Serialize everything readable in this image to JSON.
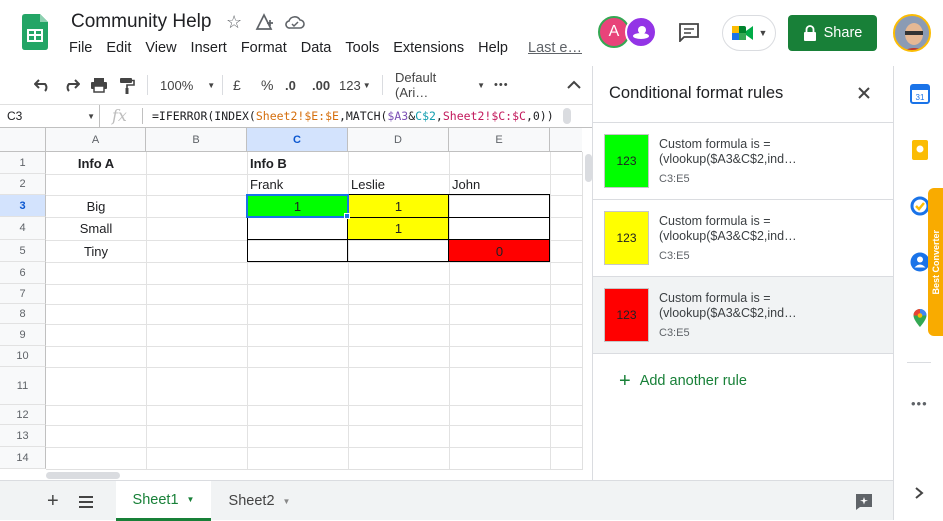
{
  "doc": {
    "title": "Community Help",
    "last_edit": "Last e…",
    "share_label": "Share",
    "avatar_letter": "A"
  },
  "menu": [
    "File",
    "Edit",
    "View",
    "Insert",
    "Format",
    "Data",
    "Tools",
    "Extensions",
    "Help"
  ],
  "toolbar": {
    "zoom": "100%",
    "currency": "£",
    "percent": "%",
    "dec_less": ".0",
    "dec_more": ".00",
    "numfmt": "123",
    "font": "Default (Ari…",
    "more": "•••"
  },
  "formula_bar": {
    "cell_ref": "C3",
    "fx": "fx",
    "formula": "=IFERROR(INDEX(Sheet2!$E:$E,MATCH($A3&C$2,Sheet2!$C:$C,0))"
  },
  "columns": [
    "A",
    "B",
    "C",
    "D",
    "E"
  ],
  "rows": [
    "1",
    "2",
    "3",
    "4",
    "5",
    "6",
    "7",
    "8",
    "9",
    "10",
    "11",
    "12",
    "13",
    "14"
  ],
  "cells": {
    "a1": "Info A",
    "c1": "Info B",
    "c2": "Frank",
    "d2": "Leslie",
    "e2": "John",
    "a3": "Big",
    "a4": "Small",
    "a5": "Tiny",
    "c3": "1",
    "d3": "1",
    "d4": "1",
    "e5": "0"
  },
  "panel": {
    "title": "Conditional format rules",
    "rules": [
      {
        "preview": "123",
        "line1": "Custom formula is =",
        "line2": "(vlookup($A3&C$2,ind…",
        "range": "C3:E5",
        "color": "#00ff00"
      },
      {
        "preview": "123",
        "line1": "Custom formula is =",
        "line2": "(vlookup($A3&C$2,ind…",
        "range": "C3:E5",
        "color": "#ffff00"
      },
      {
        "preview": "123",
        "line1": "Custom formula is =",
        "line2": "(vlookup($A3&C$2,ind…",
        "range": "C3:E5",
        "color": "#ff0000"
      }
    ],
    "add_rule": "Add another rule"
  },
  "sheets": [
    "Sheet1",
    "Sheet2"
  ],
  "colors": {
    "green_fill": "#00ff00",
    "yellow_fill": "#ffff00",
    "red_fill": "#ff0000",
    "accent": "#188038",
    "select": "#1a73e8"
  },
  "extension_tab": "Best Converter"
}
